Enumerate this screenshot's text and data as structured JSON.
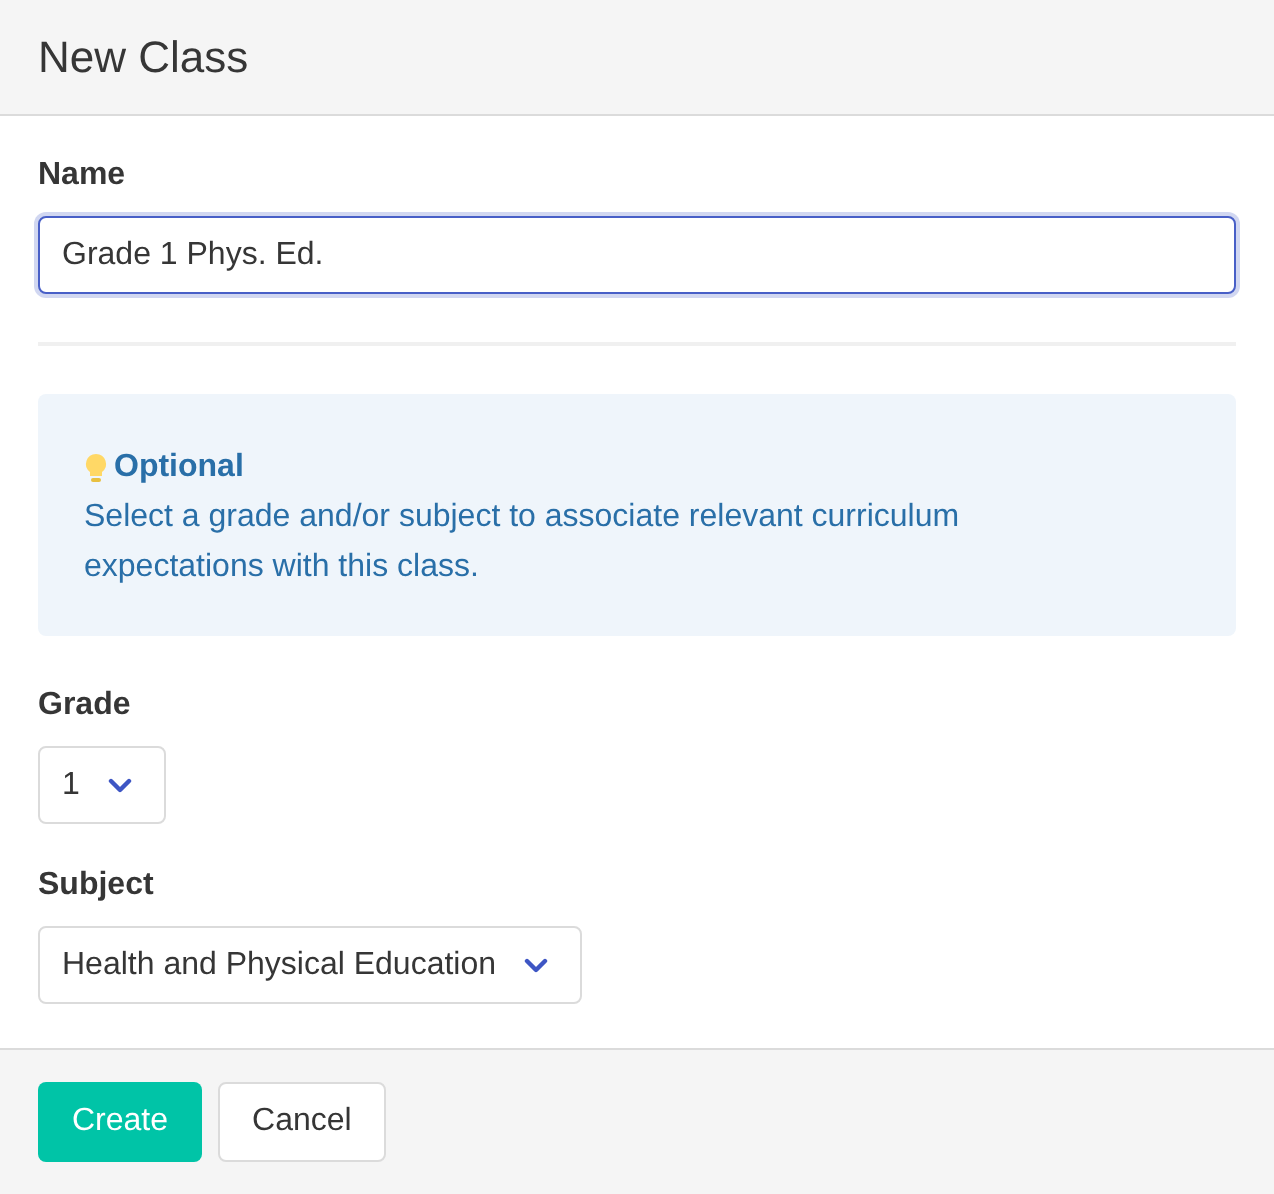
{
  "window": {
    "title": "New Class"
  },
  "name_field": {
    "label": "Name",
    "value": "Grade 1 Phys. Ed.",
    "focused": true
  },
  "notice": {
    "title": "Optional",
    "text": "Select a grade and/or subject to associate relevant curriculum expectations with this class."
  },
  "selects": [
    {
      "label": "Grade",
      "value": "1"
    },
    {
      "label": "Subject",
      "value": "Health and Physical Education"
    }
  ],
  "buttons": [
    {
      "label": "Create",
      "kind": "primary"
    },
    {
      "label": "Cancel",
      "kind": "default"
    }
  ]
}
